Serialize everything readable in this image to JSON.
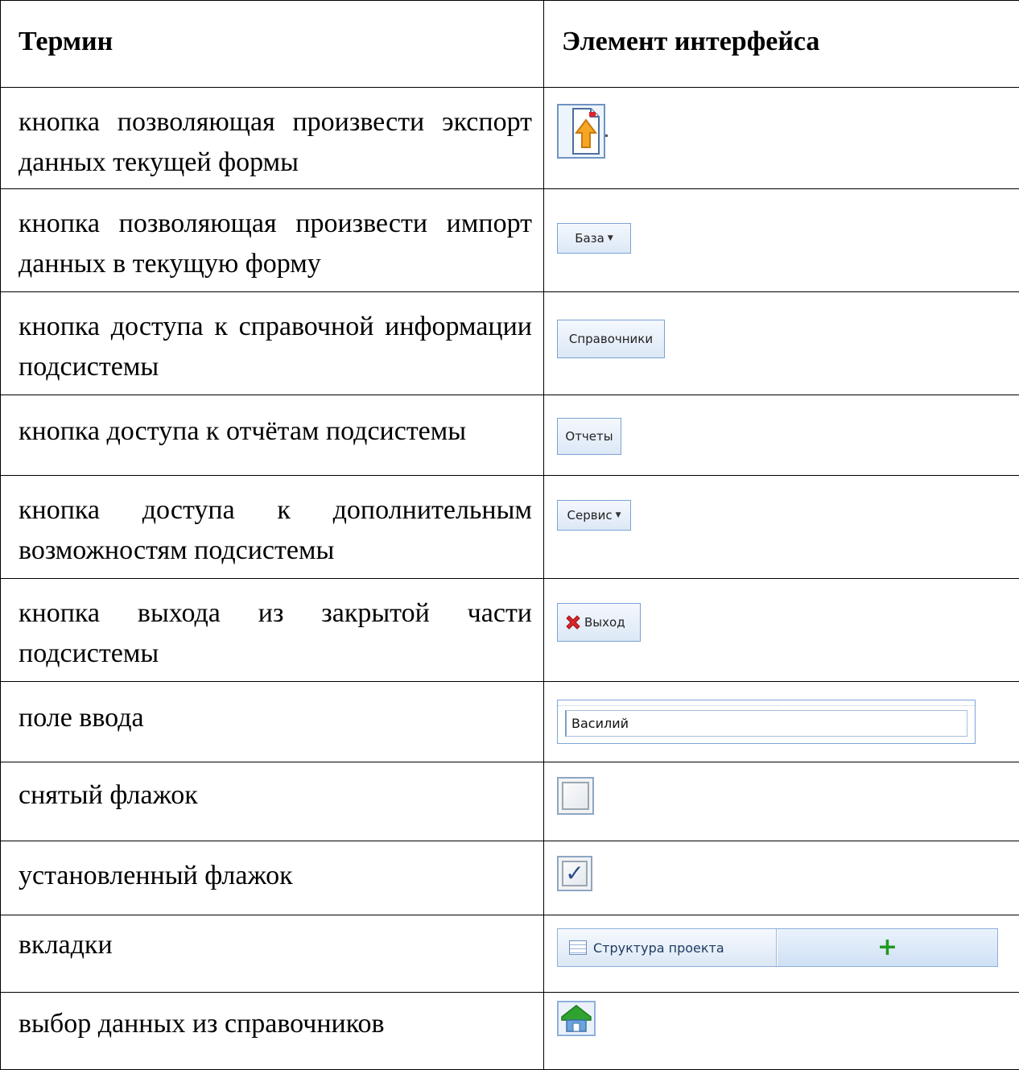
{
  "header": {
    "term": "Термин",
    "element": "Элемент интерфейса"
  },
  "rows": [
    {
      "term": "кнопка позволяющая произвести экспорт данных текущей формы",
      "icon": "export-icon"
    },
    {
      "term": "кнопка позволяющая произвести импорт данных в текущую форму",
      "button_label": "База"
    },
    {
      "term": "кнопка доступа к справочной информации подсистемы",
      "button_label": "Справочники"
    },
    {
      "term": "кнопка доступа к отчётам подсистемы",
      "button_label": "Отчеты"
    },
    {
      "term": "кнопка доступа к дополнительным возможностям подсистемы",
      "button_label": "Сервис"
    },
    {
      "term": "кнопка выхода из закрытой части подсистемы",
      "button_label": "Выход",
      "icon": "red-x-icon"
    },
    {
      "term": "поле ввода",
      "input_value": "Василий"
    },
    {
      "term": "снятый флажок",
      "checked": false
    },
    {
      "term": "установленный флажок",
      "checked": true
    },
    {
      "term": "вкладки",
      "tab_label": "Структура проекта",
      "add_tab": "+"
    },
    {
      "term": "выбор данных из справочников",
      "icon": "reference-select-icon"
    }
  ],
  "colors": {
    "button_border": "#7aa3d4",
    "button_bg": "#dce8f6",
    "plus_green": "#1f9a1f",
    "exit_red": "#d8262a"
  }
}
